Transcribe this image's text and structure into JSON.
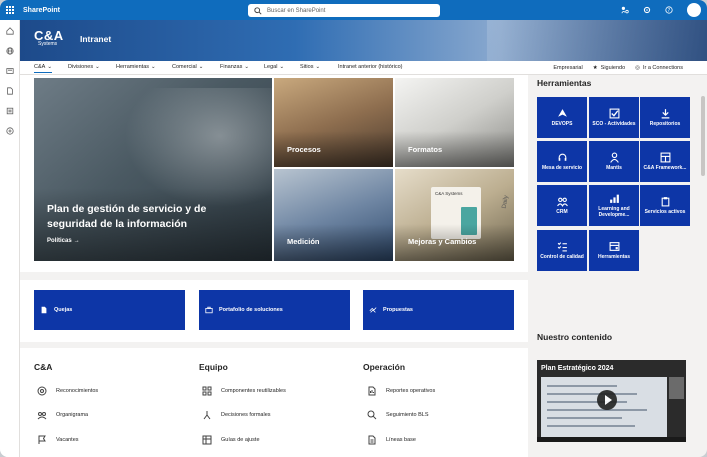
{
  "suite": {
    "app_name": "SharePoint",
    "search_placeholder": "Buscar en SharePoint"
  },
  "header": {
    "logo_text": "C&A",
    "logo_subtext": "Systems",
    "site_title": "Intranet"
  },
  "nav": {
    "items": [
      {
        "label": "C&A",
        "active": true
      },
      {
        "label": "Divisiones"
      },
      {
        "label": "Herramientas"
      },
      {
        "label": "Comercial"
      },
      {
        "label": "Finanzas"
      },
      {
        "label": "Legal"
      },
      {
        "label": "Sitios"
      },
      {
        "label": "Intranet anterior (histórico)"
      }
    ],
    "right": {
      "empresarial": "Empresarial",
      "siguiendo": "Siguiendo",
      "connections": "Ir a Connections"
    }
  },
  "hero": {
    "main_title": "Plan de gestión de servicio y de seguridad de la información",
    "main_link": "Políticas",
    "tiles": [
      "Procesos",
      "Formatos",
      "Medición",
      "Mejoras y Cambios"
    ],
    "doc_card_text": "C&A Systems",
    "doc_card_side_text": "Daily"
  },
  "quick_links": [
    "Quejas",
    "Portafolio de soluciones",
    "Propuestas"
  ],
  "lists": [
    {
      "title": "C&A",
      "items": [
        "Reconocimientos",
        "Organigrama",
        "Vacantes"
      ]
    },
    {
      "title": "Equipo",
      "items": [
        "Componentes reutilizables",
        "Decisiones formales",
        "Guías de ajuste"
      ]
    },
    {
      "title": "Operación",
      "items": [
        "Reportes operativos",
        "Seguimiento BLS",
        "Líneas base"
      ]
    }
  ],
  "tools": {
    "title": "Herramientas",
    "items": [
      {
        "label": "DEVOPS",
        "icon": "devops-icon"
      },
      {
        "label": "SCO - Actividades",
        "icon": "checkbox-icon"
      },
      {
        "label": "Repositorios",
        "icon": "download-icon"
      },
      {
        "label": "Mesa de servicio",
        "icon": "headset-icon"
      },
      {
        "label": "Mantis",
        "icon": "person-icon"
      },
      {
        "label": "C&A Framework...",
        "icon": "framework-icon"
      },
      {
        "label": "CRM",
        "icon": "people-icon"
      },
      {
        "label": "Learning and Developme...",
        "icon": "chart-icon"
      },
      {
        "label": "Servicios activos",
        "icon": "clipboard-icon"
      },
      {
        "label": "Control de calidad",
        "icon": "checklist-icon"
      },
      {
        "label": "Herramientas",
        "icon": "tools-icon"
      }
    ]
  },
  "content": {
    "title": "Nuestro contenido",
    "video_title": "Plan Estratégico 2024"
  },
  "colors": {
    "suite_blue": "#0f6cbd",
    "tile_blue": "#0d36a7"
  }
}
